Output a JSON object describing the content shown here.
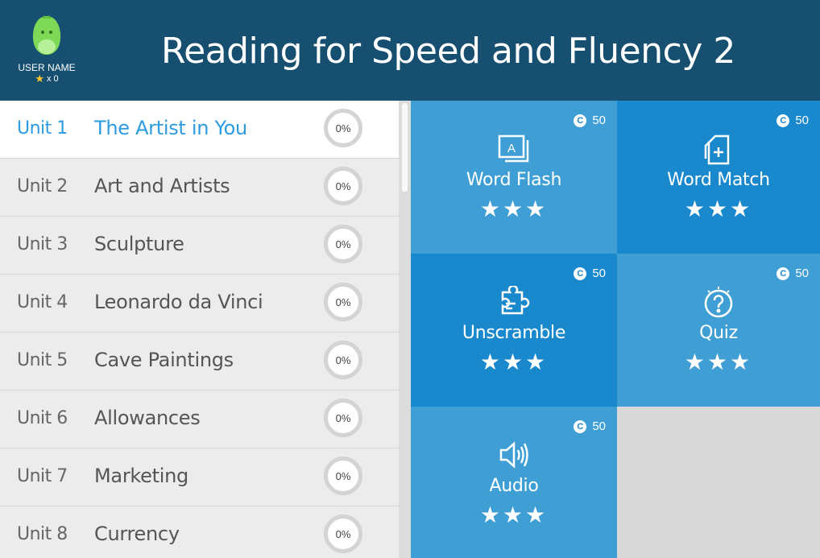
{
  "header": {
    "title": "Reading for Speed and Fluency 2",
    "user_name": "USER NAME",
    "star_count": "x 0"
  },
  "units": [
    {
      "number": "Unit 1",
      "name": "The Artist in You",
      "progress": "0%",
      "active": true
    },
    {
      "number": "Unit 2",
      "name": "Art and Artists",
      "progress": "0%"
    },
    {
      "number": "Unit 3",
      "name": "Sculpture",
      "progress": "0%"
    },
    {
      "number": "Unit 4",
      "name": "Leonardo da Vinci",
      "progress": "0%"
    },
    {
      "number": "Unit 5",
      "name": "Cave Paintings",
      "progress": "0%"
    },
    {
      "number": "Unit 6",
      "name": "Allowances",
      "progress": "0%"
    },
    {
      "number": "Unit 7",
      "name": "Marketing",
      "progress": "0%"
    },
    {
      "number": "Unit 8",
      "name": "Currency",
      "progress": "0%"
    }
  ],
  "activities": [
    {
      "label": "Word Flash",
      "coins": "50",
      "icon": "flashcard-icon",
      "stars": "★★★"
    },
    {
      "label": "Word Match",
      "coins": "50",
      "icon": "card-add-icon",
      "stars": "★★★"
    },
    {
      "label": "Unscramble",
      "coins": "50",
      "icon": "puzzle-icon",
      "stars": "★★★"
    },
    {
      "label": "Quiz",
      "coins": "50",
      "icon": "question-icon",
      "stars": "★★★"
    },
    {
      "label": "Audio",
      "coins": "50",
      "icon": "speaker-icon",
      "stars": "★★★"
    }
  ],
  "colors": {
    "header_bg": "#174f70",
    "tile_light": "#3f9fd5",
    "tile_dark": "#1a88cc",
    "active_text": "#2d9be0",
    "mascot": "#7ed957"
  }
}
